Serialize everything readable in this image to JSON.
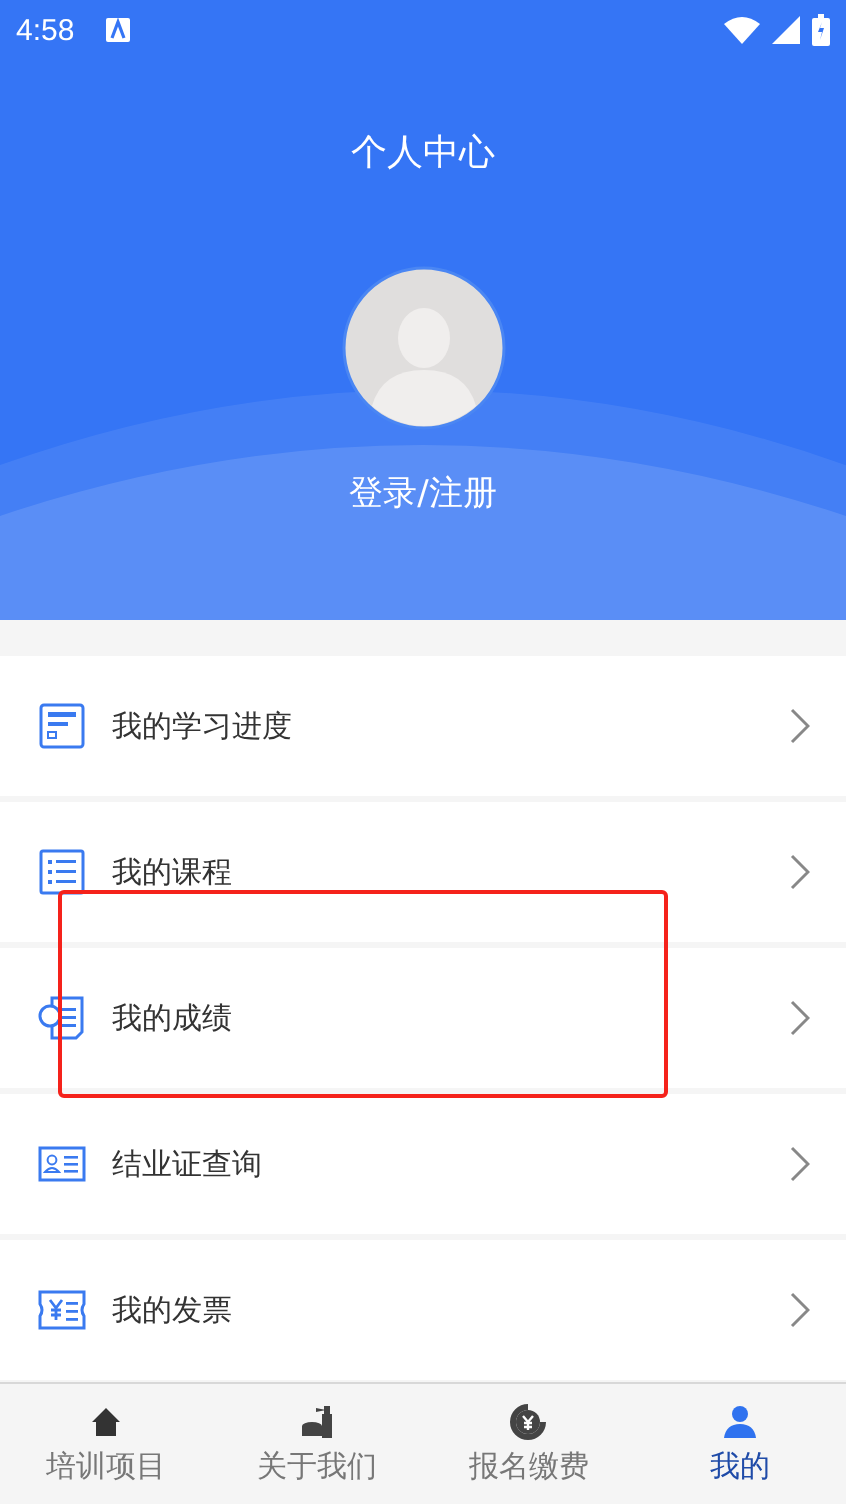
{
  "status_bar": {
    "time": "4:58"
  },
  "header": {
    "title": "个人中心",
    "login_label": "登录/注册"
  },
  "menu": [
    {
      "label": "我的学习进度",
      "kind": "progress"
    },
    {
      "label": "我的课程",
      "kind": "list"
    },
    {
      "label": "我的成绩",
      "kind": "score"
    },
    {
      "label": "结业证查询",
      "kind": "certificate"
    },
    {
      "label": "我的发票",
      "kind": "invoice"
    }
  ],
  "annotation": {
    "kind": "frame"
  },
  "bottom_nav": [
    {
      "label": "培训项目",
      "kind": "home",
      "selected": false
    },
    {
      "label": "关于我们",
      "kind": "about",
      "selected": false
    },
    {
      "label": "报名缴费",
      "kind": "payment",
      "selected": false
    },
    {
      "label": "我的",
      "kind": "user",
      "selected": true
    }
  ]
}
